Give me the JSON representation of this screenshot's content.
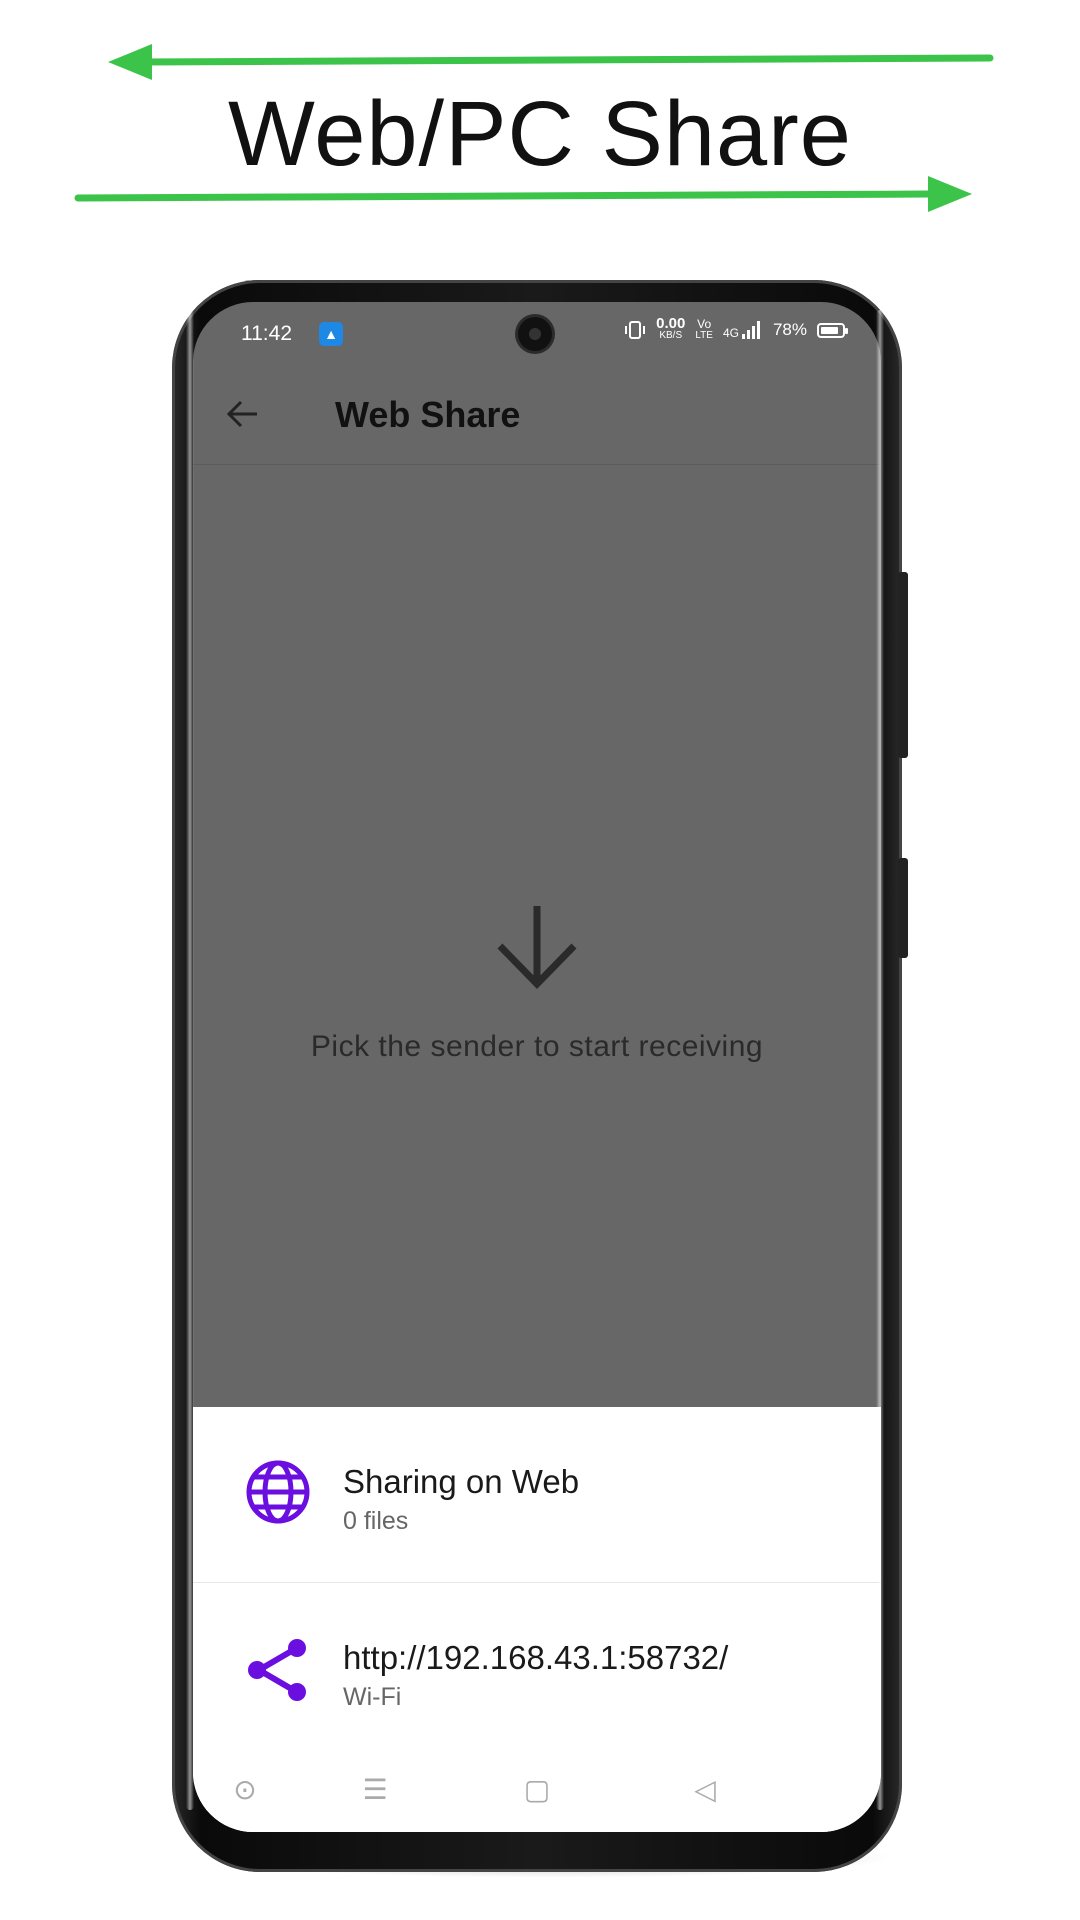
{
  "promo": {
    "title": "Web/PC Share",
    "arrow_color": "#3cc34a"
  },
  "status_bar": {
    "time": "11:42",
    "app_icon": "android-icon",
    "net_speed_value": "0.00",
    "net_speed_unit": "KB/S",
    "volte_top": "Vo",
    "volte_bottom": "LTE",
    "network": "4G",
    "battery": "78%"
  },
  "app_bar": {
    "title": "Web Share",
    "back_icon": "arrow-left-icon"
  },
  "empty_state": {
    "icon": "arrow-down-icon",
    "message": "Pick the sender to start receiving"
  },
  "bottom_sheet": {
    "accent_color": "#6a0fe0",
    "rows": [
      {
        "icon": "globe-icon",
        "title": "Sharing on Web",
        "subtitle": "0 files"
      },
      {
        "icon": "share-icon",
        "title": "http://192.168.43.1:58732/",
        "subtitle": "Wi-Fi"
      }
    ]
  },
  "nav_bar": {
    "buttons": [
      "assistant-icon",
      "menu-icon",
      "home-square-icon",
      "back-triangle-icon"
    ]
  }
}
